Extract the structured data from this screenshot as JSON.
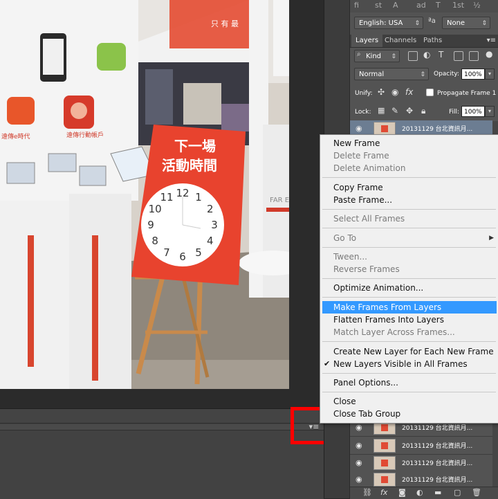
{
  "character_panel": {
    "glyphs": [
      "fi",
      "st",
      "A",
      "ad",
      "T",
      "1st",
      "½"
    ],
    "language": "English: USA",
    "aa_label": "ªa",
    "antialias": "None"
  },
  "layers_panel": {
    "tabs": [
      "Layers",
      "Channels",
      "Paths"
    ],
    "active_tab": "Layers",
    "filter_kind": "Kind",
    "blend_mode": "Normal",
    "opacity_label": "Opacity:",
    "opacity_value": "100%",
    "unify_label": "Unify:",
    "propagate_label": "Propagate Frame 1",
    "lock_label": "Lock:",
    "fill_label": "Fill:",
    "fill_value": "100%",
    "layer_rows": [
      "20131129 台北資訊月...",
      "20131129 台北資訊月...",
      "20131129 台北資訊月...",
      "20131129 台北資訊月...",
      "20131129 台北資訊月..."
    ]
  },
  "context_menu": {
    "items": [
      {
        "label": "New Frame",
        "enabled": true
      },
      {
        "label": "Delete Frame",
        "enabled": false
      },
      {
        "label": "Delete Animation",
        "enabled": false
      },
      {
        "label": "Copy Frame",
        "enabled": true
      },
      {
        "label": "Paste Frame...",
        "enabled": true
      },
      {
        "label": "Select All Frames",
        "enabled": false
      },
      {
        "label": "Go To",
        "enabled": false
      },
      {
        "label": "Tween...",
        "enabled": false
      },
      {
        "label": "Reverse Frames",
        "enabled": false
      },
      {
        "label": "Optimize Animation...",
        "enabled": true
      },
      {
        "label": "Make Frames From Layers",
        "enabled": true
      },
      {
        "label": "Flatten Frames Into Layers",
        "enabled": true
      },
      {
        "label": "Match Layer Across Frames...",
        "enabled": false
      },
      {
        "label": "Create New Layer for Each New Frame",
        "enabled": true
      },
      {
        "label": "New Layers Visible in All Frames",
        "enabled": true
      },
      {
        "label": "Panel Options...",
        "enabled": true
      },
      {
        "label": "Close",
        "enabled": true
      },
      {
        "label": "Close Tab Group",
        "enabled": true
      }
    ],
    "highlighted_item": "Make Frames From Layers",
    "checked_item": "New Layers Visible in All Frames"
  },
  "photo": {
    "sign_line1": "下一場",
    "sign_line2": "活動時間",
    "clock_numbers": [
      "12",
      "1",
      "2",
      "3",
      "4",
      "5",
      "6",
      "7",
      "8",
      "9",
      "10",
      "11"
    ],
    "banner_text": "FAR EA",
    "top_sign": "只 有 最",
    "panel_text_1": "遠傳e時代",
    "panel_text_2": "遠傳行動帳戶"
  },
  "colors": {
    "highlight_box": "#ff0000",
    "menu_highlight": "#3399ff",
    "selected_layer": "#6c7d92",
    "sign_red": "#e8432e"
  }
}
